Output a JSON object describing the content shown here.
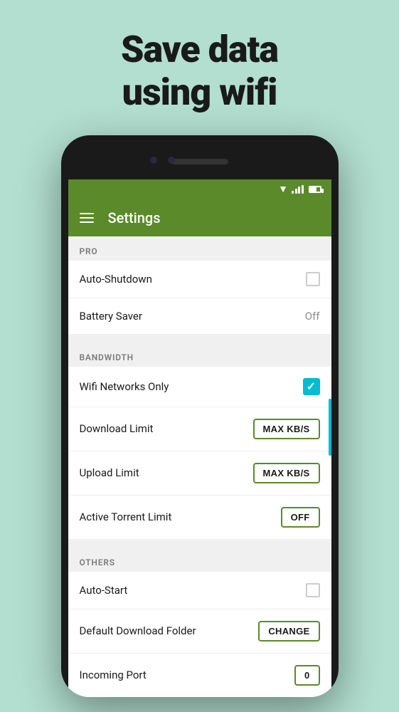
{
  "hero": {
    "line1": "Save data",
    "line2": "using wifi"
  },
  "app": {
    "title": "Settings"
  },
  "sections": {
    "pro": {
      "label": "PRO",
      "items": [
        {
          "id": "auto-shutdown",
          "label": "Auto-Shutdown",
          "control": "checkbox",
          "value": false
        },
        {
          "id": "battery-saver",
          "label": "Battery Saver",
          "control": "text",
          "value": "Off"
        }
      ]
    },
    "bandwidth": {
      "label": "BANDWIDTH",
      "items": [
        {
          "id": "wifi-networks-only",
          "label": "Wifi Networks Only",
          "control": "checkbox-checked",
          "value": true
        },
        {
          "id": "download-limit",
          "label": "Download Limit",
          "control": "button",
          "value": "MAX KB/S"
        },
        {
          "id": "upload-limit",
          "label": "Upload Limit",
          "control": "button",
          "value": "MAX KB/S"
        },
        {
          "id": "active-torrent-limit",
          "label": "Active Torrent Limit",
          "control": "button",
          "value": "OFF"
        }
      ]
    },
    "others": {
      "label": "OTHERS",
      "items": [
        {
          "id": "auto-start",
          "label": "Auto-Start",
          "control": "checkbox",
          "value": false
        },
        {
          "id": "default-download-folder",
          "label": "Default Download Folder",
          "control": "button",
          "value": "CHANGE"
        },
        {
          "id": "incoming-port",
          "label": "Incoming Port",
          "control": "button",
          "value": "0"
        }
      ]
    }
  }
}
